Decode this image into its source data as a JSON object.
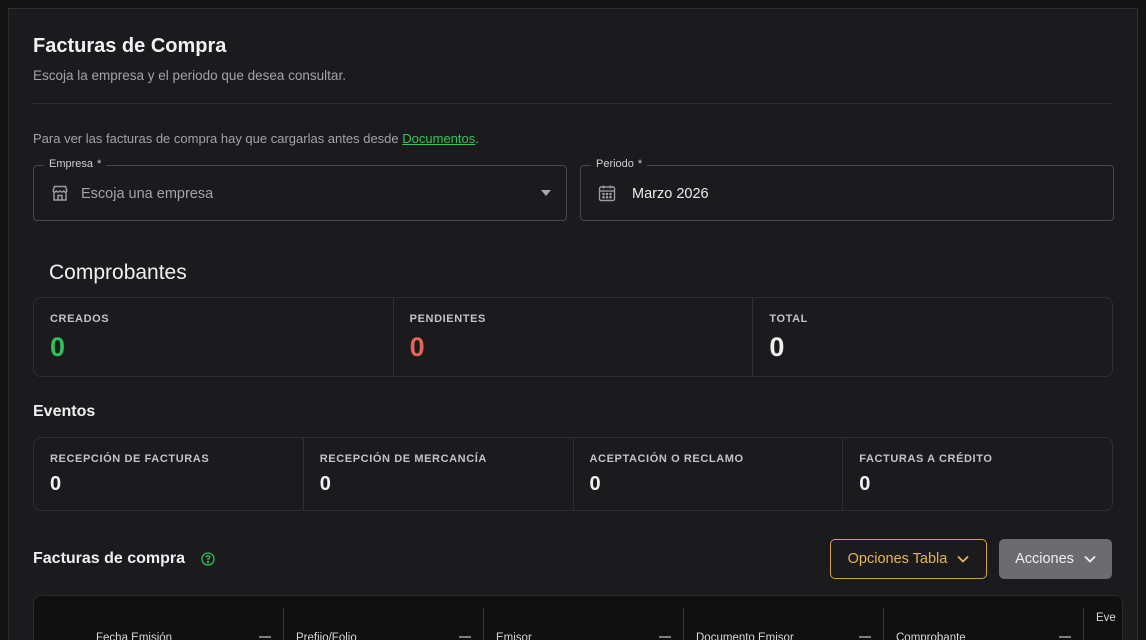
{
  "page": {
    "title": "Facturas de Compra",
    "subtitle": "Escoja la empresa y el periodo que desea consultar.",
    "notice_prefix": "Para ver las facturas de compra hay que cargarlas antes desde ",
    "notice_link": "Documentos",
    "notice_suffix": "."
  },
  "filters": {
    "empresa": {
      "label": "Empresa",
      "required_mark": "*",
      "placeholder": "Escoja una empresa",
      "icon": "store-icon"
    },
    "periodo": {
      "label": "Periodo",
      "required_mark": "*",
      "value": "Marzo 2026",
      "icon": "calendar-icon"
    }
  },
  "comprobantes": {
    "heading": "Comprobantes",
    "cards": [
      {
        "label": "CREADOS",
        "value": "0",
        "color": "#2fbf5b"
      },
      {
        "label": "PENDIENTES",
        "value": "0",
        "color": "#e5645a"
      },
      {
        "label": "TOTAL",
        "value": "0",
        "color": "#f0f0f2"
      }
    ]
  },
  "eventos": {
    "heading": "Eventos",
    "cards": [
      {
        "label": "RECEPCIÓN DE FACTURAS",
        "value": "0"
      },
      {
        "label": "RECEPCIÓN DE MERCANCÍA",
        "value": "0"
      },
      {
        "label": "ACEPTACIÓN O RECLAMO",
        "value": "0"
      },
      {
        "label": "FACTURAS A CRÉDITO",
        "value": "0"
      }
    ]
  },
  "facturas": {
    "heading": "Facturas de compra",
    "help_icon": "help-circle-icon",
    "opciones_label": "Opciones Tabla",
    "acciones_label": "Acciones",
    "columns": [
      "Fecha Emisión",
      "Prefijo/Folio",
      "Emisor",
      "Documento Emisor",
      "Comprobante",
      "Eve"
    ]
  },
  "colors": {
    "accent_green": "#34c759",
    "accent_orange": "#e5b45a",
    "panel_bg": "#1b1b1d"
  }
}
